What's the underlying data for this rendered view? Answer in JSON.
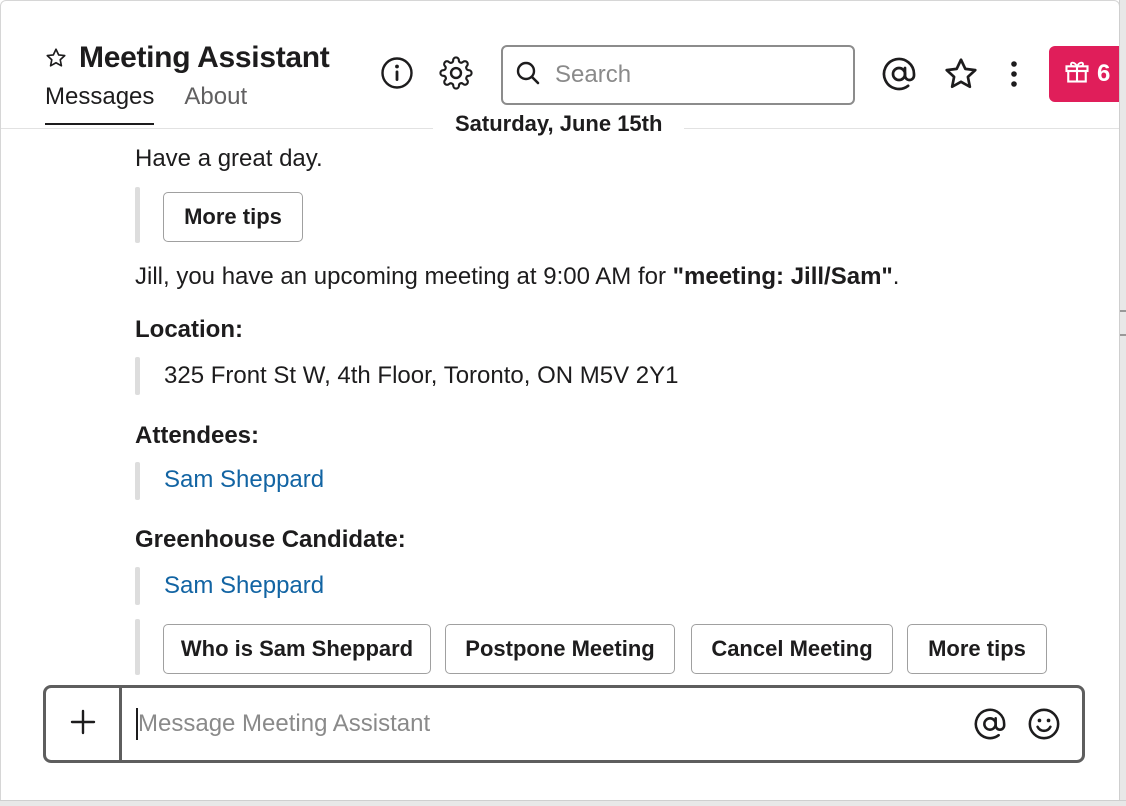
{
  "header": {
    "title": "Meeting Assistant",
    "tabs": [
      {
        "label": "Messages",
        "active": true
      },
      {
        "label": "About",
        "active": false
      }
    ],
    "search_placeholder": "Search",
    "gift_count": "6",
    "icons": [
      "star-outline-icon",
      "info-icon",
      "gear-icon",
      "search-icon",
      "at-icon",
      "star-icon",
      "more-vertical-icon",
      "gift-icon"
    ]
  },
  "date_divider": "Saturday, June 15th",
  "messages": {
    "greeting": "Have a great day.",
    "more_tips_1": "More tips",
    "meeting_intro_prefix": "Jill, you have an upcoming meeting at 9:00 AM for ",
    "meeting_name": "\"meeting: Jill/Sam\"",
    "meeting_suffix": ".",
    "location_label": "Location:",
    "location_value": "325 Front St W, 4th Floor, Toronto, ON M5V 2Y1",
    "attendees_label": "Attendees:",
    "attendee": "Sam Sheppard",
    "candidate_label": "Greenhouse Candidate:",
    "candidate": "Sam Sheppard",
    "actions": [
      "Who is Sam Sheppard",
      "Postpone Meeting",
      "Cancel Meeting",
      "More tips"
    ]
  },
  "composer": {
    "placeholder": "Message Meeting Assistant"
  },
  "colors": {
    "accent_badge": "#e01e5a",
    "link": "#1264a3",
    "text": "#1d1c1d"
  }
}
